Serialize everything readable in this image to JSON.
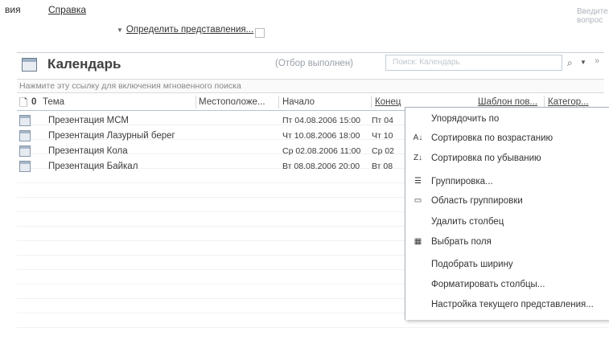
{
  "menubar": {
    "item_partial": "вия",
    "help": "Справка",
    "ask_placeholder": "Введите вопрос"
  },
  "define_views": "Определить представления...",
  "calendar": {
    "title": "Календарь",
    "filter_status": "(Отбор выполнен)",
    "search_placeholder": "Поиск: Календарь"
  },
  "instant_search_hint": "Нажмите эту ссылку для включения мгновенного поиска",
  "columns": {
    "subject": "Тема",
    "location": "Местоположе...",
    "start": "Начало",
    "end": "Конец",
    "pattern": "Шаблон пов...",
    "category": "Категор..."
  },
  "rows": [
    {
      "subject": "Презентация МСМ",
      "start": "Пт 04.08.2006 15:00",
      "end": "Пт 04"
    },
    {
      "subject": "Презентация Лазурный берег",
      "start": "Чт 10.08.2006 18:00",
      "end": "Чт 10"
    },
    {
      "subject": "Презентация Кола",
      "start": "Ср 02.08.2006 11:00",
      "end": "Ср 02"
    },
    {
      "subject": "Презентация Байкал",
      "start": "Вт 08.08.2006 20:00",
      "end": "Вт 08"
    }
  ],
  "context_menu": [
    {
      "label": "Упорядочить по",
      "icon": ""
    },
    {
      "label": "Сортировка по возрастанию",
      "icon": "sort-ascending-icon"
    },
    {
      "label": "Сортировка по убыванию",
      "icon": "sort-descending-icon"
    },
    {
      "label": "Группировка...",
      "icon": "group-by-icon"
    },
    {
      "label": "Область группировки",
      "icon": "group-area-icon"
    },
    {
      "label": "Удалить столбец",
      "icon": ""
    },
    {
      "label": "Выбрать поля",
      "icon": "field-chooser-icon"
    },
    {
      "label": "Подобрать ширину",
      "icon": ""
    },
    {
      "label": "Форматировать столбцы...",
      "icon": ""
    },
    {
      "label": "Настройка текущего представления...",
      "icon": ""
    }
  ]
}
